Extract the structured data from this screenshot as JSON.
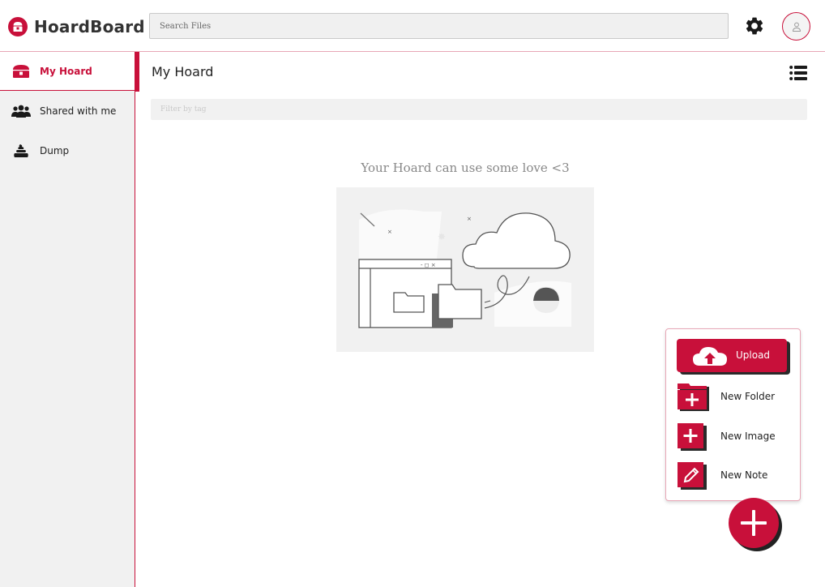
{
  "app": {
    "brand_name": "HoardBoard",
    "accent_color": "#c8103a"
  },
  "header": {
    "search_placeholder": "Search Files"
  },
  "sidebar": {
    "items": [
      {
        "label": "My Hoard",
        "icon": "treasure-chest-icon",
        "active": true
      },
      {
        "label": "Shared with me",
        "icon": "users-icon",
        "active": false
      },
      {
        "label": "Dump",
        "icon": "dump-icon",
        "active": false
      }
    ]
  },
  "main": {
    "title": "My Hoard",
    "filter_placeholder": "Filter by tag",
    "empty_message": "Your Hoard can use some love <3"
  },
  "create_menu": {
    "upload_label": "Upload",
    "new_folder_label": "New Folder",
    "new_image_label": "New Image",
    "new_note_label": "New Note"
  }
}
